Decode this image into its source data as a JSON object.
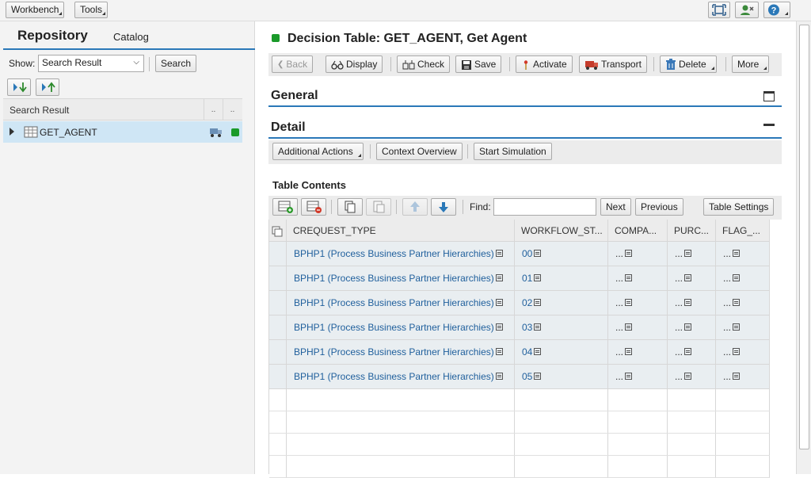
{
  "topbar": {
    "workbench": "Workbench",
    "tools": "Tools"
  },
  "left": {
    "tab_repository": "Repository",
    "tab_catalog": "Catalog",
    "show_label": "Show:",
    "show_value": "Search Result",
    "search_button": "Search",
    "result_header": "Search Result",
    "col_dots": "..",
    "result_item": "GET_AGENT"
  },
  "main": {
    "title": "Decision Table: GET_AGENT, Get Agent",
    "toolbar": {
      "back": "Back",
      "display": "Display",
      "check": "Check",
      "save": "Save",
      "activate": "Activate",
      "transport": "Transport",
      "delete": "Delete",
      "more": "More"
    },
    "section_general": "General",
    "section_detail": "Detail",
    "detail_toolbar": {
      "additional_actions": "Additional Actions",
      "context_overview": "Context Overview",
      "start_simulation": "Start Simulation"
    },
    "table_contents_title": "Table Contents",
    "table_toolbar": {
      "find_label": "Find:",
      "find_value": "",
      "next": "Next",
      "previous": "Previous",
      "table_settings": "Table Settings"
    },
    "columns": [
      "CREQUEST_TYPE",
      "WORKFLOW_ST...",
      "COMPA...",
      "PURC...",
      "FLAG_..."
    ],
    "rows": [
      {
        "request_type": "BPHP1 (Process Business Partner Hierarchies)",
        "workflow_step": "00",
        "company": "...",
        "purchase": "...",
        "flag": "..."
      },
      {
        "request_type": "BPHP1 (Process Business Partner Hierarchies)",
        "workflow_step": "01",
        "company": "...",
        "purchase": "...",
        "flag": "..."
      },
      {
        "request_type": "BPHP1 (Process Business Partner Hierarchies)",
        "workflow_step": "02",
        "company": "...",
        "purchase": "...",
        "flag": "..."
      },
      {
        "request_type": "BPHP1 (Process Business Partner Hierarchies)",
        "workflow_step": "03",
        "company": "...",
        "purchase": "...",
        "flag": "..."
      },
      {
        "request_type": "BPHP1 (Process Business Partner Hierarchies)",
        "workflow_step": "04",
        "company": "...",
        "purchase": "...",
        "flag": "..."
      },
      {
        "request_type": "BPHP1 (Process Business Partner Hierarchies)",
        "workflow_step": "05",
        "company": "...",
        "purchase": "...",
        "flag": "..."
      }
    ]
  },
  "colors": {
    "accent_blue": "#2a78b8",
    "status_green": "#1a9a2a",
    "link_blue": "#1f5f9c",
    "selection": "#cfe6f5"
  }
}
